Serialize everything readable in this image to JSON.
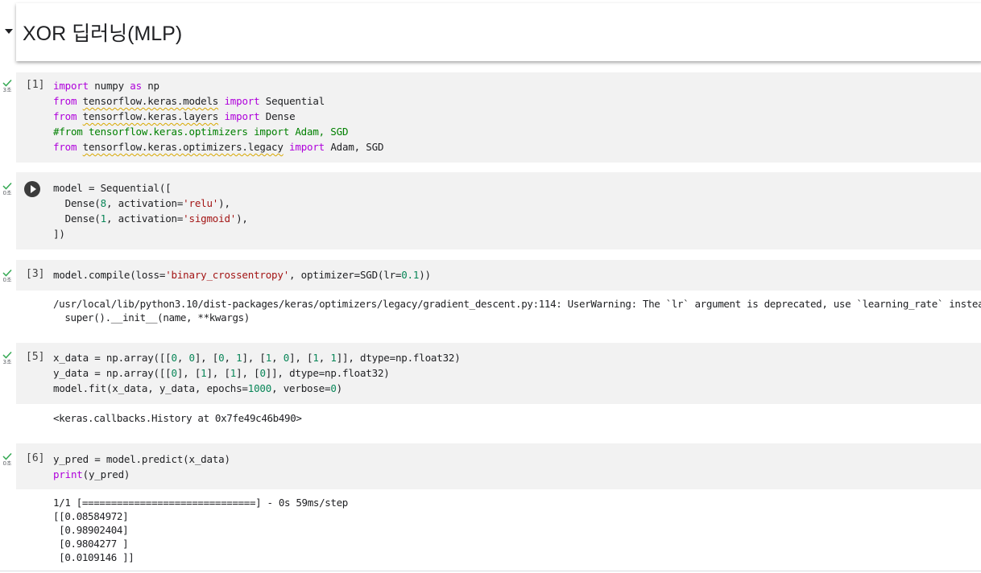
{
  "section": {
    "title": "XOR 딥러닝(MLP)"
  },
  "cells": [
    {
      "exec_label": "[1]",
      "exec_time": "3초",
      "lines": [
        [
          {
            "t": "import",
            "c": "kw"
          },
          {
            "t": " numpy "
          },
          {
            "t": "as",
            "c": "kw"
          },
          {
            "t": " np"
          }
        ],
        [
          {
            "t": "from",
            "c": "kw"
          },
          {
            "t": " "
          },
          {
            "t": "tensorflow.keras.models",
            "c": "squig"
          },
          {
            "t": " "
          },
          {
            "t": "import",
            "c": "kw"
          },
          {
            "t": " Sequential"
          }
        ],
        [
          {
            "t": "from",
            "c": "kw"
          },
          {
            "t": " "
          },
          {
            "t": "tensorflow.keras.layers",
            "c": "squig"
          },
          {
            "t": " "
          },
          {
            "t": "import",
            "c": "kw"
          },
          {
            "t": " Dense"
          }
        ],
        [
          {
            "t": "#from tensorflow.keras.optimizers import Adam, SGD",
            "c": "cmt"
          }
        ],
        [
          {
            "t": "from",
            "c": "kw"
          },
          {
            "t": " "
          },
          {
            "t": "tensorflow.keras.optimizers.legacy",
            "c": "squig"
          },
          {
            "t": " "
          },
          {
            "t": "import",
            "c": "kw"
          },
          {
            "t": " Adam, SGD"
          }
        ]
      ]
    },
    {
      "exec_label": "",
      "exec_time": "0초",
      "lines": [
        [
          {
            "t": "model = Sequential(["
          }
        ],
        [
          {
            "t": "  Dense("
          },
          {
            "t": "8",
            "c": "num"
          },
          {
            "t": ", activation="
          },
          {
            "t": "'relu'",
            "c": "str"
          },
          {
            "t": "),"
          }
        ],
        [
          {
            "t": "  Dense("
          },
          {
            "t": "1",
            "c": "num"
          },
          {
            "t": ", activation="
          },
          {
            "t": "'sigmoid'",
            "c": "str"
          },
          {
            "t": "),"
          }
        ],
        [
          {
            "t": "])"
          }
        ]
      ]
    },
    {
      "exec_label": "[3]",
      "exec_time": "0초",
      "lines": [
        [
          {
            "t": "model.compile(loss="
          },
          {
            "t": "'binary_crossentropy'",
            "c": "str"
          },
          {
            "t": ", optimizer=SGD(lr="
          },
          {
            "t": "0.1",
            "c": "num"
          },
          {
            "t": "))"
          }
        ]
      ],
      "output": "/usr/local/lib/python3.10/dist-packages/keras/optimizers/legacy/gradient_descent.py:114: UserWarning: The `lr` argument is deprecated, use `learning_rate` instead.\n  super().__init__(name, **kwargs)"
    },
    {
      "exec_label": "[5]",
      "exec_time": "3초",
      "lines": [
        [
          {
            "t": "x_data = np.array([["
          },
          {
            "t": "0",
            "c": "num"
          },
          {
            "t": ", "
          },
          {
            "t": "0",
            "c": "num"
          },
          {
            "t": "], ["
          },
          {
            "t": "0",
            "c": "num"
          },
          {
            "t": ", "
          },
          {
            "t": "1",
            "c": "num"
          },
          {
            "t": "], ["
          },
          {
            "t": "1",
            "c": "num"
          },
          {
            "t": ", "
          },
          {
            "t": "0",
            "c": "num"
          },
          {
            "t": "], ["
          },
          {
            "t": "1",
            "c": "num"
          },
          {
            "t": ", "
          },
          {
            "t": "1",
            "c": "num"
          },
          {
            "t": "]], dtype=np.float32)"
          }
        ],
        [
          {
            "t": "y_data = np.array([["
          },
          {
            "t": "0",
            "c": "num"
          },
          {
            "t": "], ["
          },
          {
            "t": "1",
            "c": "num"
          },
          {
            "t": "], ["
          },
          {
            "t": "1",
            "c": "num"
          },
          {
            "t": "], ["
          },
          {
            "t": "0",
            "c": "num"
          },
          {
            "t": "]], dtype=np.float32)"
          }
        ],
        [
          {
            "t": "model.fit(x_data, y_data, epochs="
          },
          {
            "t": "1000",
            "c": "num"
          },
          {
            "t": ", verbose="
          },
          {
            "t": "0",
            "c": "num"
          },
          {
            "t": ")"
          }
        ]
      ],
      "output": "<keras.callbacks.History at 0x7fe49c46b490>"
    },
    {
      "exec_label": "[6]",
      "exec_time": "0초",
      "lines": [
        [
          {
            "t": "y_pred = model.predict(x_data)"
          }
        ],
        [
          {
            "t": "print",
            "c": "kw"
          },
          {
            "t": "(y_pred)"
          }
        ]
      ],
      "output": "1/1 [==============================] - 0s 59ms/step\n[[0.08584972]\n [0.98902404]\n [0.9804277 ]\n [0.0109146 ]]"
    }
  ]
}
